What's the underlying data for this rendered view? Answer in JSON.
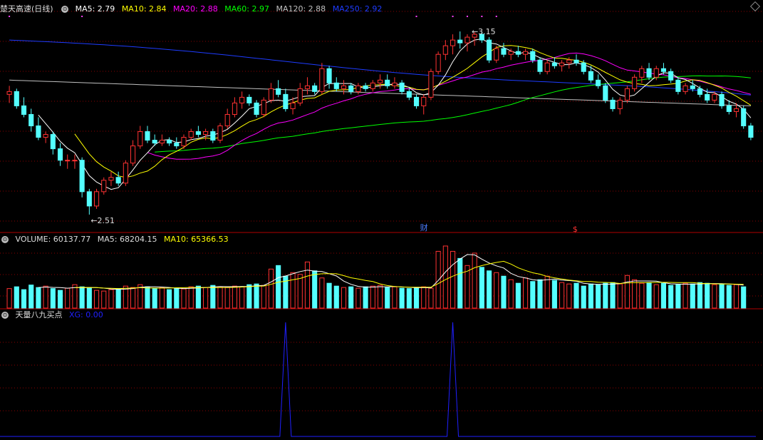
{
  "price_panel": {
    "stock_name": "楚天高速",
    "period": "(日线)",
    "ma5": "MA5: 2.79",
    "ma10": "MA10: 2.84",
    "ma20": "MA20: 2.88",
    "ma60": "MA60: 2.97",
    "ma120": "MA120: 2.88",
    "ma250": "MA250: 2.92",
    "high_label": "3.15",
    "low_label": "2.51",
    "event_marker_cai": "财",
    "event_marker_s": "$"
  },
  "volume_panel": {
    "volume": "VOLUME: 60137.77",
    "ma5": "MA5: 68204.15",
    "ma10": "MA10: 65366.53"
  },
  "indicator_panel": {
    "name": "天量八九买点",
    "xg": "XG: 0.00"
  },
  "colors": {
    "up": "#ff3232",
    "down": "#54ffff",
    "ma5": "#ffffff",
    "ma10": "#ffff00",
    "ma20": "#ff00ff",
    "ma60": "#00ff00",
    "ma120": "#c0c0c0",
    "ma250": "#1e3cff",
    "grid": "#8b0000",
    "xg": "#2020ff"
  },
  "chart_data": [
    {
      "type": "candlestick",
      "title": "楚天高速 (日线)",
      "ylim": [
        2.45,
        3.22
      ],
      "annotations": [
        {
          "text": "3.15",
          "y": 3.15
        },
        {
          "text": "2.51",
          "y": 2.51
        }
      ],
      "candles": [
        [
          2.93,
          2.96,
          2.9,
          2.94
        ],
        [
          2.94,
          2.95,
          2.88,
          2.89
        ],
        [
          2.89,
          2.92,
          2.85,
          2.86
        ],
        [
          2.86,
          2.88,
          2.8,
          2.82
        ],
        [
          2.82,
          2.85,
          2.77,
          2.78
        ],
        [
          2.78,
          2.8,
          2.76,
          2.79
        ],
        [
          2.79,
          2.8,
          2.72,
          2.74
        ],
        [
          2.74,
          2.76,
          2.68,
          2.7
        ],
        [
          2.7,
          2.72,
          2.67,
          2.7
        ],
        [
          2.7,
          2.72,
          2.67,
          2.7
        ],
        [
          2.7,
          2.71,
          2.57,
          2.59
        ],
        [
          2.59,
          2.6,
          2.51,
          2.54
        ],
        [
          2.54,
          2.6,
          2.53,
          2.59
        ],
        [
          2.59,
          2.64,
          2.58,
          2.63
        ],
        [
          2.63,
          2.66,
          2.61,
          2.64
        ],
        [
          2.64,
          2.66,
          2.61,
          2.62
        ],
        [
          2.62,
          2.7,
          2.61,
          2.69
        ],
        [
          2.69,
          2.77,
          2.68,
          2.75
        ],
        [
          2.75,
          2.82,
          2.74,
          2.8
        ],
        [
          2.8,
          2.82,
          2.76,
          2.77
        ],
        [
          2.77,
          2.79,
          2.75,
          2.76
        ],
        [
          2.76,
          2.79,
          2.75,
          2.77
        ],
        [
          2.77,
          2.78,
          2.75,
          2.76
        ],
        [
          2.76,
          2.78,
          2.74,
          2.75
        ],
        [
          2.75,
          2.79,
          2.74,
          2.78
        ],
        [
          2.78,
          2.81,
          2.77,
          2.8
        ],
        [
          2.8,
          2.82,
          2.78,
          2.79
        ],
        [
          2.79,
          2.81,
          2.77,
          2.8
        ],
        [
          2.8,
          2.81,
          2.76,
          2.77
        ],
        [
          2.77,
          2.83,
          2.76,
          2.82
        ],
        [
          2.82,
          2.88,
          2.81,
          2.86
        ],
        [
          2.86,
          2.92,
          2.85,
          2.9
        ],
        [
          2.9,
          2.94,
          2.88,
          2.92
        ],
        [
          2.92,
          2.93,
          2.89,
          2.9
        ],
        [
          2.9,
          2.91,
          2.85,
          2.86
        ],
        [
          2.86,
          2.92,
          2.85,
          2.91
        ],
        [
          2.91,
          2.97,
          2.9,
          2.95
        ],
        [
          2.95,
          2.98,
          2.92,
          2.93
        ],
        [
          2.93,
          2.95,
          2.87,
          2.88
        ],
        [
          2.88,
          2.92,
          2.86,
          2.9
        ],
        [
          2.9,
          2.97,
          2.89,
          2.95
        ],
        [
          2.95,
          2.99,
          2.93,
          2.96
        ],
        [
          2.96,
          2.97,
          2.93,
          2.94
        ],
        [
          2.94,
          3.04,
          2.93,
          3.02
        ],
        [
          3.02,
          3.03,
          2.95,
          2.97
        ],
        [
          2.97,
          2.99,
          2.94,
          2.95
        ],
        [
          2.95,
          2.98,
          2.93,
          2.96
        ],
        [
          2.96,
          2.97,
          2.93,
          2.94
        ],
        [
          2.94,
          2.97,
          2.93,
          2.96
        ],
        [
          2.96,
          2.97,
          2.94,
          2.95
        ],
        [
          2.95,
          2.98,
          2.94,
          2.97
        ],
        [
          2.97,
          3.0,
          2.95,
          2.98
        ],
        [
          2.98,
          3.0,
          2.95,
          2.96
        ],
        [
          2.96,
          2.99,
          2.95,
          2.97
        ],
        [
          2.97,
          2.98,
          2.93,
          2.94
        ],
        [
          2.94,
          2.95,
          2.91,
          2.92
        ],
        [
          2.92,
          2.93,
          2.88,
          2.89
        ],
        [
          2.89,
          2.93,
          2.86,
          2.92
        ],
        [
          2.92,
          3.02,
          2.91,
          3.01
        ],
        [
          3.01,
          3.08,
          3.0,
          3.07
        ],
        [
          3.07,
          3.12,
          3.05,
          3.1
        ],
        [
          3.1,
          3.14,
          3.07,
          3.12
        ],
        [
          3.12,
          3.15,
          3.09,
          3.11
        ],
        [
          3.11,
          3.14,
          3.08,
          3.13
        ],
        [
          3.13,
          3.15,
          3.1,
          3.14
        ],
        [
          3.14,
          3.15,
          3.11,
          3.12
        ],
        [
          3.12,
          3.13,
          3.04,
          3.05
        ],
        [
          3.05,
          3.1,
          3.04,
          3.09
        ],
        [
          3.09,
          3.11,
          3.06,
          3.07
        ],
        [
          3.07,
          3.09,
          3.05,
          3.08
        ],
        [
          3.08,
          3.1,
          3.06,
          3.07
        ],
        [
          3.07,
          3.09,
          3.05,
          3.08
        ],
        [
          3.08,
          3.09,
          3.04,
          3.05
        ],
        [
          3.05,
          3.06,
          3.0,
          3.01
        ],
        [
          3.01,
          3.05,
          3.0,
          3.04
        ],
        [
          3.04,
          3.06,
          3.02,
          3.03
        ],
        [
          3.03,
          3.05,
          3.01,
          3.04
        ],
        [
          3.04,
          3.06,
          3.02,
          3.05
        ],
        [
          3.05,
          3.07,
          3.03,
          3.04
        ],
        [
          3.04,
          3.05,
          3.0,
          3.01
        ],
        [
          3.01,
          3.03,
          2.97,
          2.98
        ],
        [
          2.98,
          3.0,
          2.95,
          2.96
        ],
        [
          2.96,
          2.97,
          2.9,
          2.91
        ],
        [
          2.91,
          2.92,
          2.87,
          2.88
        ],
        [
          2.88,
          2.92,
          2.86,
          2.91
        ],
        [
          2.91,
          2.96,
          2.9,
          2.95
        ],
        [
          2.95,
          3.0,
          2.94,
          2.99
        ],
        [
          2.99,
          3.03,
          2.97,
          3.02
        ],
        [
          3.02,
          3.04,
          2.98,
          2.99
        ],
        [
          2.99,
          3.03,
          2.98,
          3.02
        ],
        [
          3.02,
          3.04,
          3.0,
          3.01
        ],
        [
          3.01,
          3.02,
          2.97,
          2.98
        ],
        [
          2.98,
          2.99,
          2.93,
          2.94
        ],
        [
          2.94,
          2.97,
          2.93,
          2.96
        ],
        [
          2.96,
          2.98,
          2.94,
          2.95
        ],
        [
          2.95,
          2.96,
          2.92,
          2.93
        ],
        [
          2.93,
          2.95,
          2.9,
          2.91
        ],
        [
          2.91,
          2.94,
          2.9,
          2.93
        ],
        [
          2.93,
          2.94,
          2.88,
          2.89
        ],
        [
          2.89,
          2.91,
          2.86,
          2.87
        ],
        [
          2.87,
          2.9,
          2.85,
          2.88
        ],
        [
          2.88,
          2.89,
          2.81,
          2.82
        ],
        [
          2.82,
          2.83,
          2.77,
          2.78
        ]
      ]
    },
    {
      "type": "bar",
      "title": "VOLUME",
      "values": [
        55,
        60,
        52,
        65,
        58,
        62,
        55,
        50,
        56,
        66,
        60,
        58,
        50,
        48,
        52,
        55,
        62,
        58,
        66,
        60,
        55,
        58,
        52,
        56,
        54,
        60,
        62,
        58,
        64,
        60,
        58,
        62,
        60,
        66,
        68,
        64,
        110,
        120,
        90,
        100,
        95,
        130,
        105,
        85,
        70,
        62,
        58,
        60,
        56,
        60,
        62,
        64,
        58,
        60,
        56,
        55,
        58,
        60,
        56,
        160,
        175,
        160,
        140,
        120,
        155,
        115,
        105,
        100,
        90,
        80,
        70,
        85,
        75,
        80,
        90,
        78,
        72,
        68,
        70,
        62,
        68,
        66,
        70,
        72,
        68,
        92,
        80,
        70,
        72,
        66,
        70,
        64,
        66,
        70,
        68,
        72,
        70,
        66,
        68,
        64,
        66,
        60
      ]
    },
    {
      "type": "line",
      "title": "天量八九买点",
      "series": [
        {
          "name": "XG",
          "spikes_at": [
            38,
            61
          ]
        }
      ]
    }
  ]
}
